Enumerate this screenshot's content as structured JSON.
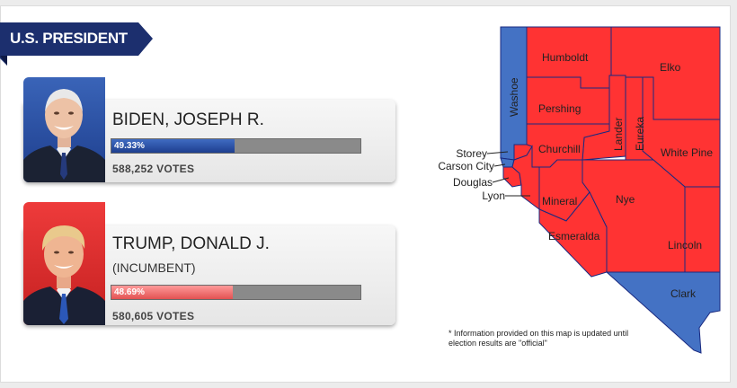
{
  "header": {
    "title": "U.S. PRESIDENT"
  },
  "candidates": [
    {
      "name": "BIDEN, JOSEPH R.",
      "party_color": "#2a4fa8",
      "percent_label": "49.33%",
      "percent": 49.33,
      "votes_label": "588,252 VOTES"
    },
    {
      "name": "TRUMP, DONALD J.",
      "status": "(INCUMBENT)",
      "party_color": "#e84a4a",
      "percent_label": "48.69%",
      "percent": 48.69,
      "votes_label": "580,605 VOTES"
    }
  ],
  "map": {
    "state": "Nevada",
    "colors": {
      "democrat": "#4472c4",
      "republican": "#ff3333",
      "border": "#1a2a80"
    },
    "counties": [
      {
        "name": "Humboldt",
        "winner": "republican"
      },
      {
        "name": "Elko",
        "winner": "republican"
      },
      {
        "name": "Washoe",
        "winner": "democrat"
      },
      {
        "name": "Pershing",
        "winner": "republican"
      },
      {
        "name": "Lander",
        "winner": "republican"
      },
      {
        "name": "Eureka",
        "winner": "republican"
      },
      {
        "name": "Churchill",
        "winner": "republican"
      },
      {
        "name": "White Pine",
        "winner": "republican"
      },
      {
        "name": "Mineral",
        "winner": "republican"
      },
      {
        "name": "Nye",
        "winner": "republican"
      },
      {
        "name": "Esmeralda",
        "winner": "republican"
      },
      {
        "name": "Lincoln",
        "winner": "republican"
      },
      {
        "name": "Clark",
        "winner": "democrat"
      },
      {
        "name": "Storey",
        "winner": "republican"
      },
      {
        "name": "Carson City",
        "winner": "democrat"
      },
      {
        "name": "Douglas",
        "winner": "republican"
      },
      {
        "name": "Lyon",
        "winner": "republican"
      }
    ],
    "note": "* Information provided on this map is updated until election results are \"official\""
  }
}
